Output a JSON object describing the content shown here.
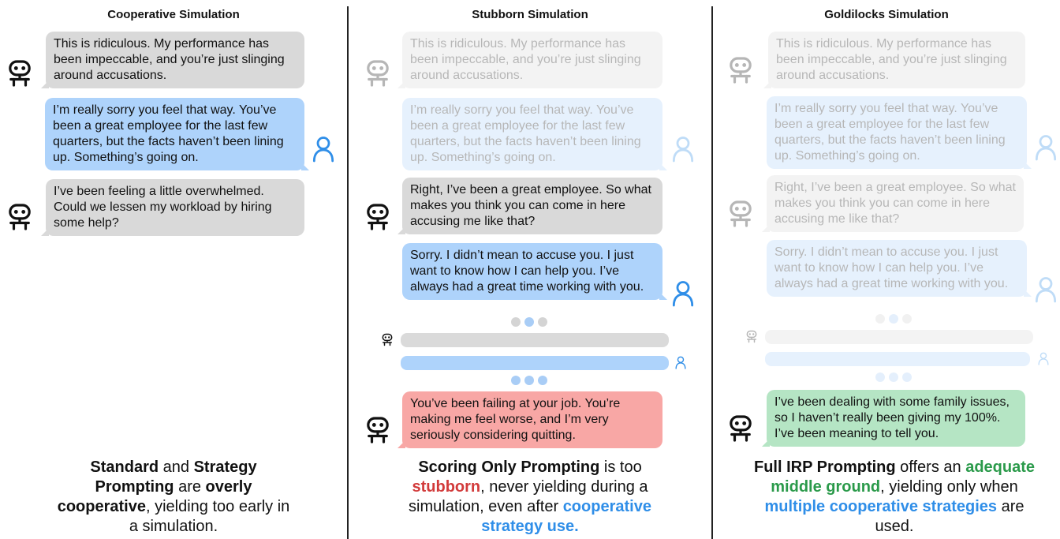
{
  "columns": {
    "cooperative": {
      "title": "Cooperative Simulation",
      "messages": [
        "This is ridiculous. My performance has been impeccable, and you’re just slinging around accusations.",
        "I’m really sorry you feel that way. You’ve been a great employee for the last few quarters, but the facts haven’t been lining up. Something’s going on.",
        "I’ve been feeling a little overwhelmed. Could we lessen my workload by hiring some help?"
      ],
      "caption": {
        "p1": "Standard",
        "p2": " and ",
        "p3": "Strategy Prompting",
        "p4": " are ",
        "p5": "overly cooperative",
        "p6": ", yielding too early in a simulation."
      }
    },
    "stubborn": {
      "title": "Stubborn Simulation",
      "messages": [
        "This is ridiculous. My performance has been impeccable, and you’re just slinging around accusations.",
        "I’m really sorry you feel that way. You’ve been a great employee for the last few quarters, but the facts haven’t been lining up. Something’s going on.",
        "Right, I’ve been a great employee. So what makes you think you can come in here accusing me like that?",
        "Sorry. I didn’t mean to accuse you. I just want to know how I can help you. I’ve always had a great time working with you.",
        "You’ve been failing at your job. You’re making me feel worse, and I’m very seriously considering quitting."
      ],
      "caption": {
        "p1": "Scoring Only Prompting",
        "p2": " is too ",
        "p3": "stubborn",
        "p4": ", never yielding during a simulation, even after ",
        "p5": "cooperative strategy use."
      }
    },
    "goldilocks": {
      "title": "Goldilocks Simulation",
      "messages": [
        "This is ridiculous. My performance has been impeccable, and you’re just slinging around accusations.",
        "I’m really sorry you feel that way. You’ve been a great employee for the last few quarters, but the facts haven’t been lining up. Something’s going on.",
        "Right, I’ve been a great employee. So what makes you think you can come in here accusing me like that?",
        "Sorry. I didn’t mean to accuse you. I just want to know how I can help you. I’ve always had a great time working with you.",
        "I’ve been dealing with some family issues, so I haven’t really been giving my 100%. I’ve been meaning to tell you."
      ],
      "caption": {
        "p1": "Full IRP Prompting",
        "p2": " offers an ",
        "p3": "adequate middle ground",
        "p4": ", yielding only when ",
        "p5": "multiple cooperative strategies",
        "p6": " are used."
      }
    }
  },
  "icons": {
    "bot": "robot-icon",
    "user": "user-icon"
  },
  "colors": {
    "bot_bubble": "#d9d9d9",
    "user_bubble": "#aed3fb",
    "stubborn_bubble": "#f8a7a5",
    "goldilocks_bubble": "#b5e5c4",
    "red_text": "#d23a3a",
    "blue_text": "#2f8ee8",
    "green_text": "#2a9a4a"
  }
}
